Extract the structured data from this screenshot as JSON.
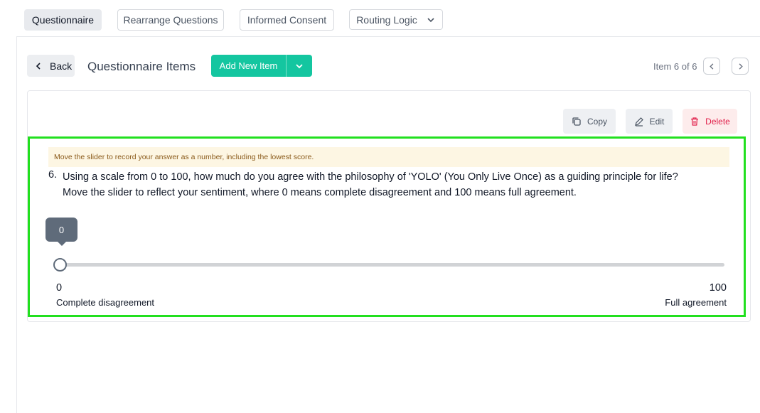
{
  "tabs": [
    {
      "label": "Questionnaire",
      "active": true
    },
    {
      "label": "Rearrange Questions",
      "active": false
    },
    {
      "label": "Informed Consent",
      "active": false
    },
    {
      "label": "Routing Logic",
      "active": false,
      "has_dropdown": true
    }
  ],
  "header": {
    "back_label": "Back",
    "title": "Questionnaire Items",
    "add_label": "Add New Item",
    "item_counter": "Item 6 of 6"
  },
  "actions": {
    "copy_label": "Copy",
    "edit_label": "Edit",
    "delete_label": "Delete"
  },
  "question": {
    "hint": "Move the slider to record your answer as a number, including the lowest score.",
    "number": "6.",
    "text_line1": "Using a scale from 0 to 100, how much do you agree with the philosophy of 'YOLO' (You Only Live Once) as a guiding principle for life?",
    "text_line2": "Move the slider to reflect your sentiment, where 0 means complete disagreement and 100 means full agreement."
  },
  "slider": {
    "value": 0,
    "value_label": "0",
    "min": 0,
    "max": 100,
    "min_value_label": "0",
    "max_value_label": "100",
    "min_label": "Complete disagreement",
    "max_label": "Full agreement"
  },
  "colors": {
    "accent": "#14c6a0",
    "highlight": "#22e01f",
    "delete": "#e11d48",
    "slider": "#5f6b7a"
  },
  "icons": {
    "back": "chevron-left-icon",
    "add_dropdown": "chevron-down-icon",
    "prev": "chevron-left-icon",
    "next": "chevron-right-icon",
    "copy": "copy-icon",
    "edit": "pencil-icon",
    "delete": "trash-icon"
  }
}
